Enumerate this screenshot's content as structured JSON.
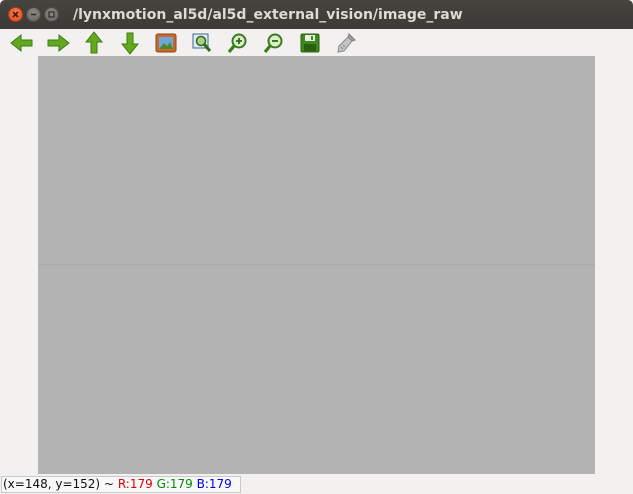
{
  "window": {
    "title": "/lynxmotion_al5d/al5d_external_vision/image_raw"
  },
  "toolbar": {
    "tools": [
      {
        "name": "back-arrow-icon",
        "color": "#4e9a06"
      },
      {
        "name": "forward-arrow-icon",
        "color": "#4e9a06"
      },
      {
        "name": "up-arrow-icon",
        "color": "#4e9a06"
      },
      {
        "name": "down-arrow-icon",
        "color": "#4e9a06"
      },
      {
        "name": "image-icon",
        "color": "#c7672a"
      },
      {
        "name": "zoom-fit-icon",
        "color": "#3b7a1e"
      },
      {
        "name": "zoom-in-icon",
        "color": "#3b7a1e"
      },
      {
        "name": "zoom-out-icon",
        "color": "#3b7a1e"
      },
      {
        "name": "save-icon",
        "color": "#3b7a1e"
      },
      {
        "name": "clear-brush-icon",
        "color": "#8a8a8a"
      }
    ]
  },
  "image": {
    "fill_color": "#b3b3b3"
  },
  "status": {
    "coords": "(x=148, y=152) ~",
    "r": "R:179",
    "g": "G:179",
    "b": "B:179"
  }
}
